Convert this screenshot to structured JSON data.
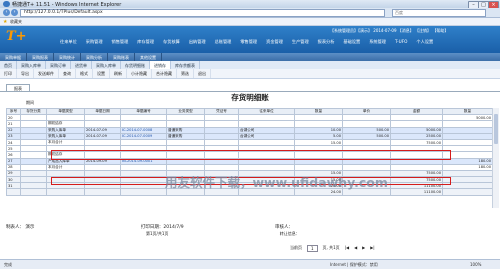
{
  "window": {
    "title": "畅捷通T+ 11.51 - Windows Internet Explorer",
    "min": "–",
    "max": "□",
    "close": "×"
  },
  "browser": {
    "address": "http://127.0.0.1/TPlus/Default.aspx",
    "search_placeholder": "百度",
    "favorites": "收藏夹"
  },
  "app": {
    "logo": "T+",
    "user_info": "【系统管理员】【演示】 2014-07-09 【消息】 【注销】 【帮助】",
    "main_menu": [
      "往来单位",
      "采购管理",
      "销售管理",
      "库存管理",
      "存货核算",
      "出纳管理",
      "总账管理",
      "零售管理",
      "资金管理",
      "生产管理",
      "报表分析",
      "基础设置",
      "系统管理",
      "T-UFO",
      "个人设置"
    ],
    "sub_menu": [
      "采购单据",
      "采购报表",
      "采购统计",
      "采购分析",
      "采购账表",
      "其他设置"
    ],
    "tabs": [
      "首页",
      "采购入库单",
      "采购订单",
      "进货单",
      "采购入库单",
      "存货明细账",
      "进销存",
      "库存余额表"
    ],
    "active_tab": 6,
    "toolbar": [
      "打印",
      "导出",
      "发送邮件",
      "查询",
      "格式",
      "设置",
      "刷新",
      "小计隐藏",
      "合计隐藏",
      "筛选",
      "退出"
    ]
  },
  "report": {
    "tab_label": "报表",
    "title": "存货明细账",
    "unit_label": "期间",
    "headers": [
      "序号",
      "存货分类",
      "单据类型",
      "单据日期",
      "单据编号",
      "业务类型",
      "凭证号",
      "往来单位",
      "数量",
      "单价",
      "金额",
      "数量"
    ],
    "group_header": "收入",
    "rows": [
      [
        "20",
        "",
        "",
        "",
        "",
        "",
        "",
        "",
        "",
        "",
        "",
        "5000.00"
      ],
      [
        "21",
        "",
        "期初结存",
        "",
        "",
        "",
        "",
        "",
        "",
        "",
        "",
        ""
      ],
      [
        "22",
        "",
        "采购入库单",
        "2014-07-09",
        "IC-2014-07-0008",
        "普通采购",
        "",
        "台湖公司",
        "10.00",
        "500.00",
        "5000.00",
        ""
      ],
      [
        "23",
        "",
        "采购入库单",
        "2014-07-09",
        "IC-2014-07-0009",
        "普通采购",
        "",
        "台湖公司",
        "5.00",
        "500.00",
        "2500.00",
        ""
      ],
      [
        "24",
        "",
        "本月合计",
        "",
        "",
        "",
        "",
        "",
        "15.00",
        "",
        "7500.00",
        ""
      ],
      [
        "25",
        "",
        "",
        "",
        "",
        "",
        "",
        "",
        "",
        "",
        "",
        ""
      ],
      [
        "26",
        "",
        "期初结存",
        "",
        "",
        "",
        "",
        "",
        "",
        "",
        "",
        ""
      ],
      [
        "27",
        "",
        "产成品入库单",
        "2014-09-09",
        "IN-2014-09-0001",
        "",
        "",
        "",
        "",
        "",
        "",
        "180.00"
      ],
      [
        "28",
        "",
        "本月合计",
        "",
        "",
        "",
        "",
        "",
        "",
        "",
        "",
        "180.00"
      ],
      [
        "29",
        "",
        "",
        "",
        "",
        "",
        "",
        "",
        "15.00",
        "",
        "7500.00",
        ""
      ],
      [
        "30",
        "",
        "",
        "",
        "",
        "",
        "",
        "",
        "15.00",
        "",
        "7500.00",
        ""
      ],
      [
        "31",
        "",
        "",
        "",
        "",
        "",
        "",
        "",
        "24.00",
        "",
        "11100.00",
        ""
      ],
      [
        "",
        "",
        "",
        "",
        "",
        "",
        "",
        "",
        "24.00",
        "",
        "11100.00",
        ""
      ]
    ],
    "total_label": "合计",
    "footer_left": "制表人：    演示",
    "footer_print": "打印日期：2014/7/9",
    "footer_audit": "审核人：",
    "footer_ack": "转让信息：",
    "page_info": "第1页/共1页",
    "pager": {
      "label": "当前页",
      "current": "1",
      "of": "页, 共1页"
    }
  },
  "watermark": "用友软件下载，www.ufidawhy.com",
  "status": {
    "left": "完成",
    "zone": "Internet | 保护模式：禁用",
    "zoom": "100%"
  }
}
